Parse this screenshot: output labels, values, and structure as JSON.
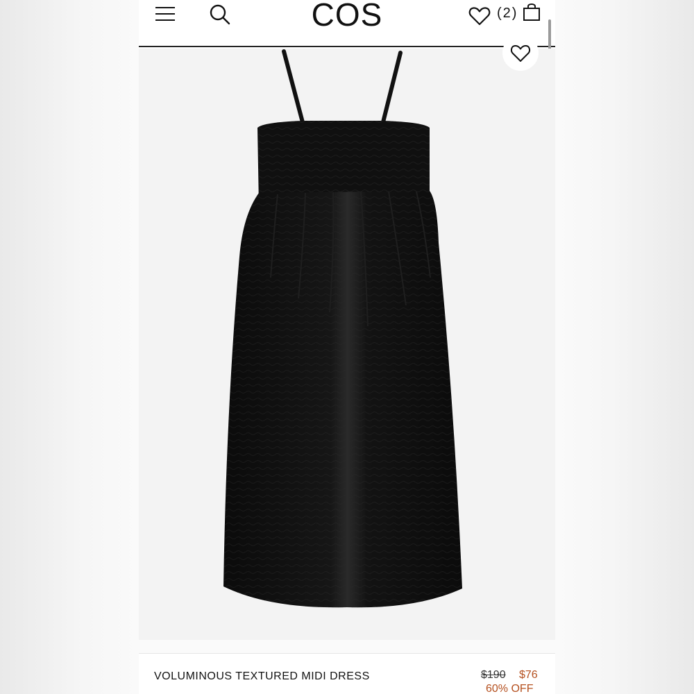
{
  "header": {
    "logo": "COS",
    "wishlist_count": "(2)",
    "icons": [
      "menu-icon",
      "search-icon",
      "heart-icon",
      "bag-icon"
    ]
  },
  "product": {
    "name": "VOLUMINOUS TEXTURED MIDI DRESS",
    "original_price": "$190",
    "sale_price": "$76",
    "discount": "60% OFF",
    "image_icon": "heart-icon"
  },
  "colors": {
    "sale": "#b5501f",
    "text": "#111111",
    "image_bg": "#f3f3f3"
  }
}
